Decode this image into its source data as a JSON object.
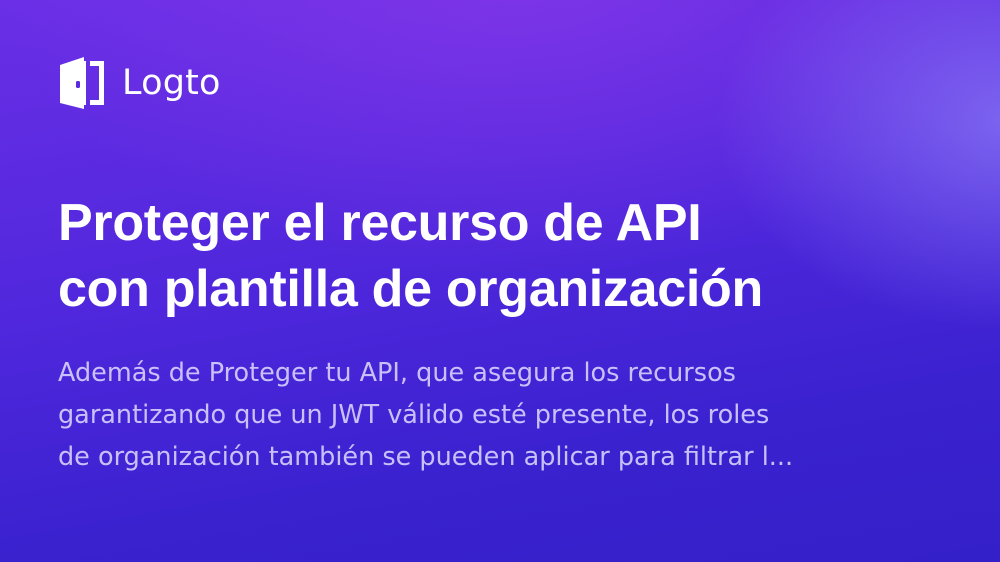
{
  "brand": {
    "name": "Logto",
    "logo_icon": "door-logo-icon"
  },
  "title": {
    "lines": [
      "Proteger el recurso de API",
      "con plantilla de organización"
    ]
  },
  "description": {
    "lines": [
      "Además de Proteger tu API, que asegura los recursos",
      "garantizando que un JWT válido esté presente, los roles",
      "de organización también se pueden aplicar para filtrar l..."
    ]
  },
  "colors": {
    "background_top": "#6a2fe6",
    "background_bottom": "#3420c8",
    "title": "#ffffff",
    "description": "#dcd6ff"
  }
}
